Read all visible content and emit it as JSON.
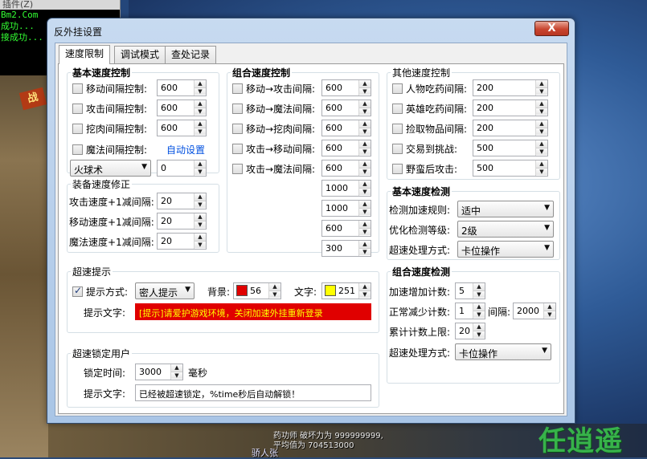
{
  "background": {
    "console_title": "插件(Z)",
    "console_lines": [
      "Bm2.Com",
      "成功...",
      "接成功..."
    ],
    "corner_sign": "战",
    "status_lines": [
      "药功师 破坏力为 999999999,",
      "平均值为 704513000"
    ],
    "player_name": "骄人张",
    "watermark": "任逍遥"
  },
  "window": {
    "title": "反外挂设置",
    "close_label": "X",
    "tabs": [
      {
        "label": "速度限制",
        "active": true
      },
      {
        "label": "调试模式",
        "active": false
      },
      {
        "label": "查处记录",
        "active": false
      }
    ]
  },
  "basic_speed": {
    "title": "基本速度控制",
    "items": [
      {
        "label": "移动间隔控制:",
        "value": "600"
      },
      {
        "label": "攻击间隔控制:",
        "value": "600"
      },
      {
        "label": "挖肉间隔控制:",
        "value": "600"
      },
      {
        "label": "魔法间隔控制:"
      }
    ],
    "auto_setting_link": "自动设置",
    "magic_select": "火球术",
    "magic_value": "0"
  },
  "equip_speed": {
    "title": "装备速度修正",
    "items": [
      {
        "label": "攻击速度+1减间隔:",
        "value": "20"
      },
      {
        "label": "移动速度+1减间隔:",
        "value": "20"
      },
      {
        "label": "魔法速度+1减间隔:",
        "value": "20"
      }
    ]
  },
  "combo_speed": {
    "title": "组合速度控制",
    "items": [
      {
        "label": "移动→攻击间隔:",
        "value": "600"
      },
      {
        "label": "移动→魔法间隔:",
        "value": "600"
      },
      {
        "label": "移动→挖肉间隔:",
        "value": "600"
      },
      {
        "label": "攻击→移动间隔:",
        "value": "600"
      },
      {
        "label": "攻击→魔法间隔:",
        "value": "600"
      }
    ],
    "extra_values": [
      "1000",
      "1000",
      "600",
      "300"
    ]
  },
  "other_speed": {
    "title": "其他速度控制",
    "items": [
      {
        "label": "人物吃药间隔:",
        "value": "200"
      },
      {
        "label": "英雄吃药间隔:",
        "value": "200"
      },
      {
        "label": "捡取物品间隔:",
        "value": "200"
      },
      {
        "label": "交易到挑战:",
        "value": "500"
      },
      {
        "label": "野蛮后攻击:",
        "value": "500"
      }
    ]
  },
  "basic_detect": {
    "title": "基本速度检测",
    "rule_label": "检测加速规则:",
    "rule_value": "适中",
    "level_label": "优化检测等级:",
    "level_value": "2级",
    "handle_label": "超速处理方式:",
    "handle_value": "卡位操作"
  },
  "combo_detect": {
    "title": "组合速度检测",
    "add_label": "加速增加计数:",
    "add_value": "5",
    "dec_label": "正常减少计数:",
    "dec_value": "1",
    "interval_label": "间隔:",
    "interval_value": "2000",
    "limit_label": "累计计数上限:",
    "limit_value": "20",
    "handle_label": "超速处理方式:",
    "handle_value": "卡位操作"
  },
  "overspeed_tip": {
    "title": "超速提示",
    "mode_label": "提示方式:",
    "mode_value": "密人提示",
    "bg_label": "背景:",
    "bg_value": "56",
    "bg_color": "#e00000",
    "text_label": "文字:",
    "text_value": "251",
    "text_color": "#ffff00",
    "tip_label": "提示文字:",
    "tip_text": "[提示]请爱护游戏环境，关闭加速外挂重新登录"
  },
  "lock_user": {
    "title": "超速锁定用户",
    "time_label": "锁定时间:",
    "time_value": "3000",
    "time_unit": "毫秒",
    "tip_label": "提示文字:",
    "tip_text": "已经被超速锁定，%time秒后自动解锁！"
  }
}
